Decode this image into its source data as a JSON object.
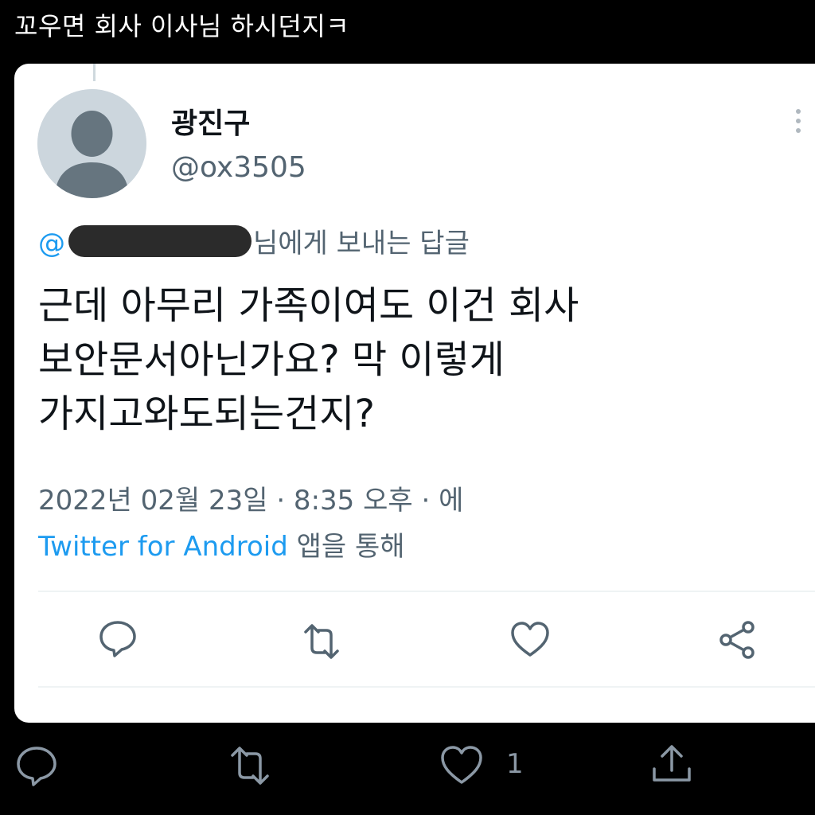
{
  "caption": "꼬우면 회사 이사님 하시던지ㅋ",
  "tweet": {
    "display_name": "광진구",
    "handle": "@ox3505",
    "reply_prefix": "@",
    "reply_suffix": "님에게 보내는 답글",
    "text": "근데 아무리 가족이여도 이건 회사\n보안문서아닌가요? 막 이렇게\n가지고와도되는건지?",
    "timestamp": "2022년 02월 23일 · 8:35 오후 · 에",
    "source": "Twitter for Android",
    "source_suffix": " 앱을 통해"
  },
  "actions": [
    "reply-icon",
    "retweet-icon",
    "like-icon",
    "share-icon"
  ],
  "outer_actions": {
    "icons": [
      "reply-icon",
      "retweet-icon",
      "like-icon",
      "upload-icon"
    ],
    "like_count": "1"
  },
  "colors": {
    "background": "#000000",
    "card": "#ffffff",
    "link_blue": "#1d9bf0",
    "secondary_text": "#536471"
  }
}
